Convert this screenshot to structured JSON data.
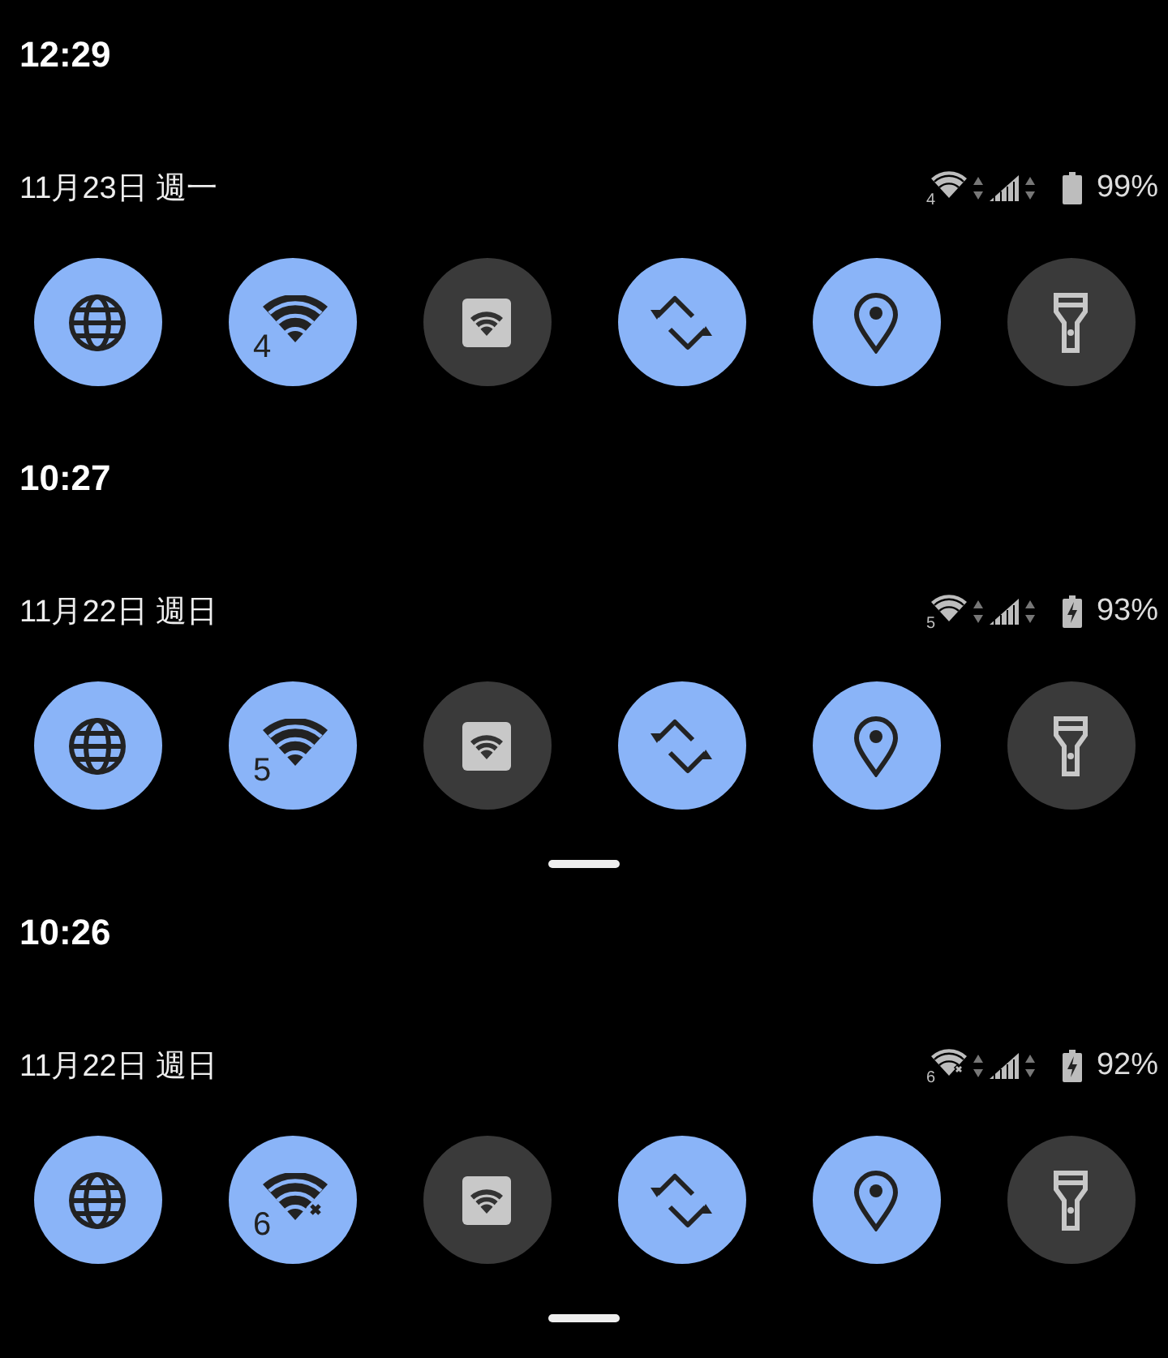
{
  "panels": [
    {
      "time": "12:29",
      "date": "11月23日 週一",
      "status": {
        "wifi_label": "4",
        "no_internet": false,
        "battery": "99%",
        "charging": false
      },
      "tiles": [
        {
          "kind": "globe",
          "on": true
        },
        {
          "kind": "wifi",
          "on": true,
          "label": "4",
          "no_internet": false
        },
        {
          "kind": "hotspot",
          "on": false
        },
        {
          "kind": "sync",
          "on": true
        },
        {
          "kind": "location",
          "on": true
        },
        {
          "kind": "flashlight",
          "on": false
        }
      ],
      "handle": false
    },
    {
      "time": "10:27",
      "date": "11月22日 週日",
      "status": {
        "wifi_label": "5",
        "no_internet": false,
        "battery": "93%",
        "charging": true
      },
      "tiles": [
        {
          "kind": "globe",
          "on": true
        },
        {
          "kind": "wifi",
          "on": true,
          "label": "5",
          "no_internet": false
        },
        {
          "kind": "hotspot",
          "on": false
        },
        {
          "kind": "sync",
          "on": true
        },
        {
          "kind": "location",
          "on": true
        },
        {
          "kind": "flashlight",
          "on": false
        }
      ],
      "handle": true
    },
    {
      "time": "10:26",
      "date": "11月22日 週日",
      "status": {
        "wifi_label": "6",
        "no_internet": true,
        "battery": "92%",
        "charging": true
      },
      "tiles": [
        {
          "kind": "globe",
          "on": true
        },
        {
          "kind": "wifi",
          "on": true,
          "label": "6",
          "no_internet": true
        },
        {
          "kind": "hotspot",
          "on": false
        },
        {
          "kind": "sync",
          "on": true
        },
        {
          "kind": "location",
          "on": true
        },
        {
          "kind": "flashlight",
          "on": false
        }
      ],
      "handle": true
    }
  ]
}
